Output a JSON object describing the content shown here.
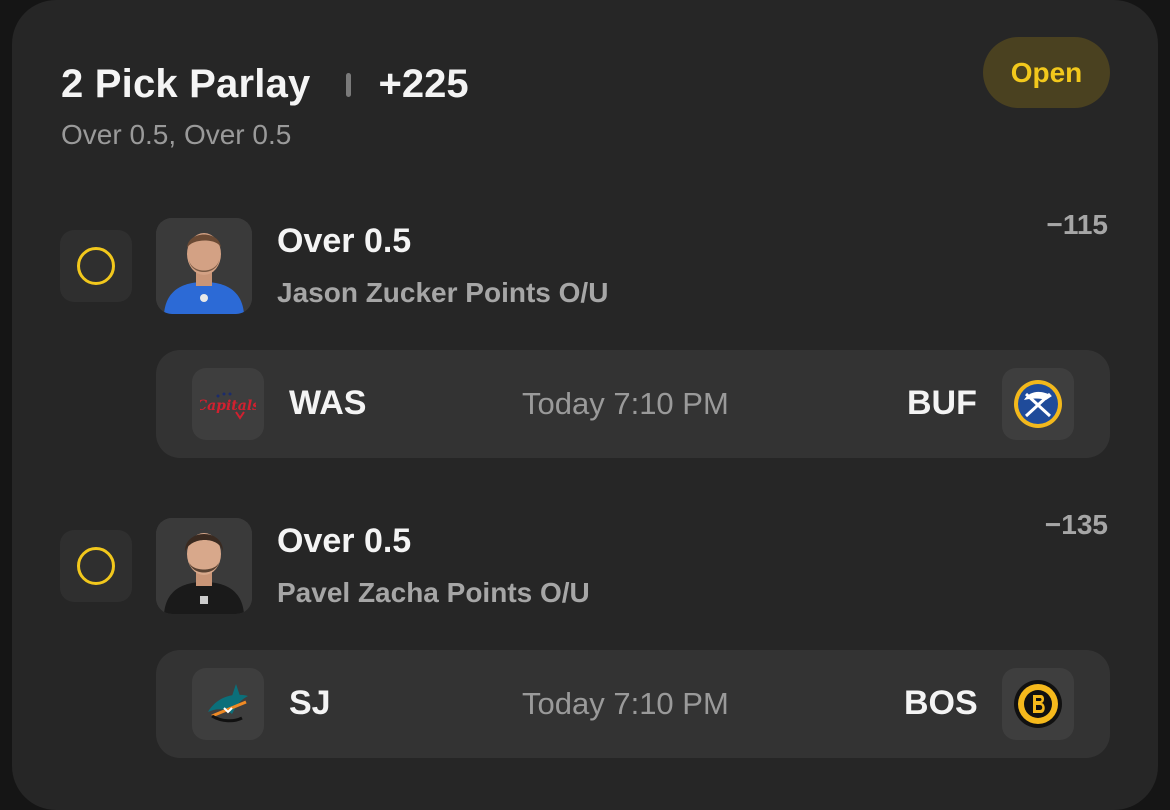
{
  "header": {
    "title": "2 Pick Parlay",
    "odds": "+225",
    "subtitle": "Over 0.5, Over 0.5",
    "status": "Open"
  },
  "colors": {
    "card_bg": "#262626",
    "accent": "#f2c81c",
    "badge_bg": "#4a4120",
    "text_primary": "#f4f4f4",
    "text_secondary": "#9a9a9a"
  },
  "picks": [
    {
      "line": "Over 0.5",
      "market": "Jason Zucker Points O/U",
      "odds": "−115",
      "headshot_icon": "player-headshot-blue-jersey",
      "game": {
        "away_team": "WAS",
        "away_logo_icon": "capitals-logo-icon",
        "time": "Today 7:10 PM",
        "home_team": "BUF",
        "home_logo_icon": "sabres-logo-icon"
      }
    },
    {
      "line": "Over 0.5",
      "market": "Pavel Zacha Points O/U",
      "odds": "−135",
      "headshot_icon": "player-headshot-black-jersey",
      "game": {
        "away_team": "SJ",
        "away_logo_icon": "sharks-logo-icon",
        "time": "Today 7:10 PM",
        "home_team": "BOS",
        "home_logo_icon": "bruins-logo-icon"
      }
    }
  ]
}
